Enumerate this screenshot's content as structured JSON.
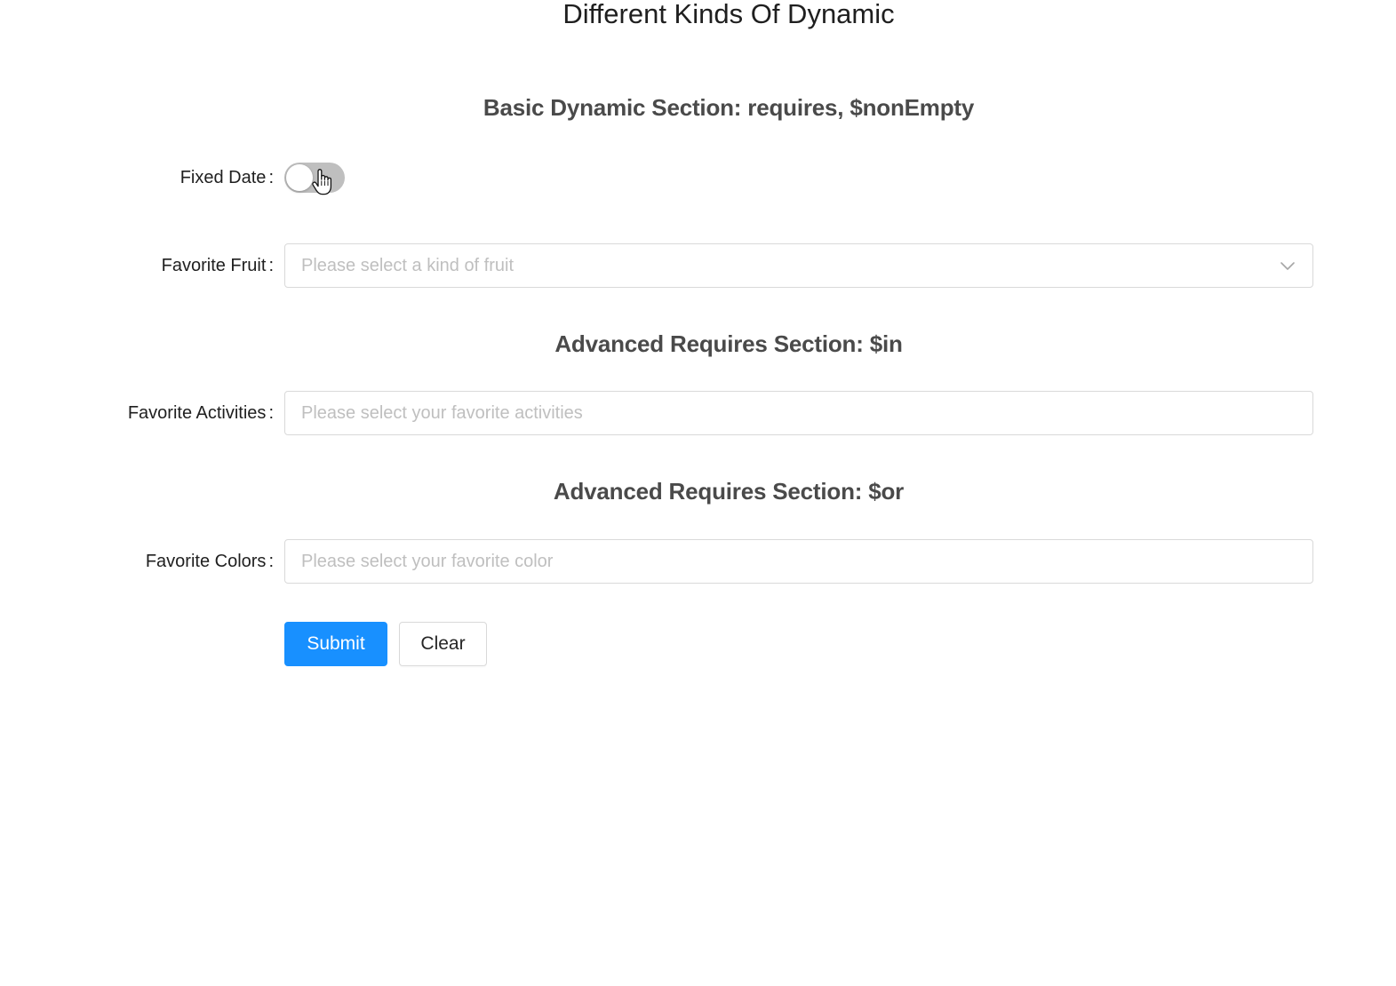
{
  "page": {
    "title": "Different Kinds Of Dynamic"
  },
  "sections": {
    "basic": {
      "title": "Basic Dynamic Section: requires, $nonEmpty"
    },
    "advanced_in": {
      "title": "Advanced Requires Section: $in"
    },
    "advanced_or": {
      "title": "Advanced Requires Section: $or"
    }
  },
  "form": {
    "fixed_date": {
      "label": "Fixed Date",
      "colon": ":",
      "checked": false
    },
    "favorite_fruit": {
      "label": "Favorite Fruit",
      "colon": ":",
      "placeholder": "Please select a kind of fruit",
      "icon": "chevron-down-icon"
    },
    "favorite_activities": {
      "label": "Favorite Activities",
      "colon": ":",
      "placeholder": "Please select your favorite activities"
    },
    "favorite_colors": {
      "label": "Favorite Colors",
      "colon": ":",
      "placeholder": "Please select your favorite color"
    },
    "buttons": {
      "submit": "Submit",
      "clear": "Clear"
    }
  },
  "colors": {
    "primary": "#1890ff",
    "switch_off": "#bfbfbf",
    "border": "#d9d9d9",
    "placeholder": "#bfbfbf"
  },
  "cursor": {
    "icon": "hand-pointer-icon"
  }
}
